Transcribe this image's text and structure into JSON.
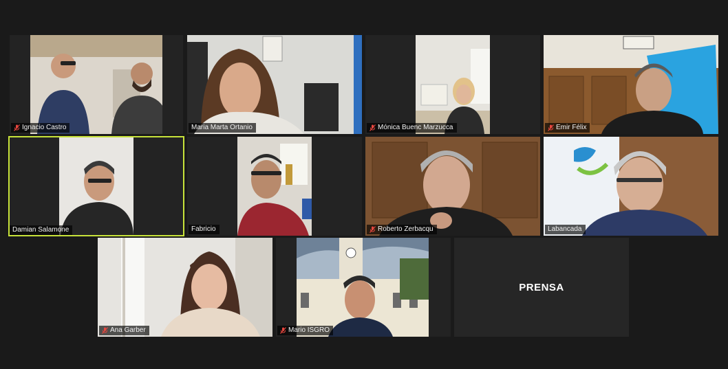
{
  "meeting": {
    "layout": "gallery",
    "active_speaker": "Damian Salamone"
  },
  "participants": [
    {
      "name": "Ignacio Castro",
      "muted": true
    },
    {
      "name": "Maria Marta Ortanio",
      "muted": false
    },
    {
      "name": "Mónica Buenc Marzucca",
      "muted": true
    },
    {
      "name": "Emir Félix",
      "muted": true
    },
    {
      "name": "Damian Salamone",
      "muted": false
    },
    {
      "name": "Fabricio",
      "muted": false
    },
    {
      "name": "Roberto Zerbacqu",
      "muted": true
    },
    {
      "name": "Labancada",
      "muted": false
    },
    {
      "name": "Ana Garber",
      "muted": true
    },
    {
      "name": "Mario ISGRO",
      "muted": true
    },
    {
      "name": "PRENSA",
      "muted": false
    }
  ],
  "colors": {
    "background": "#1a1a1a",
    "active_speaker_border": "#c8e33a",
    "muted_mic": "#e8473f"
  }
}
